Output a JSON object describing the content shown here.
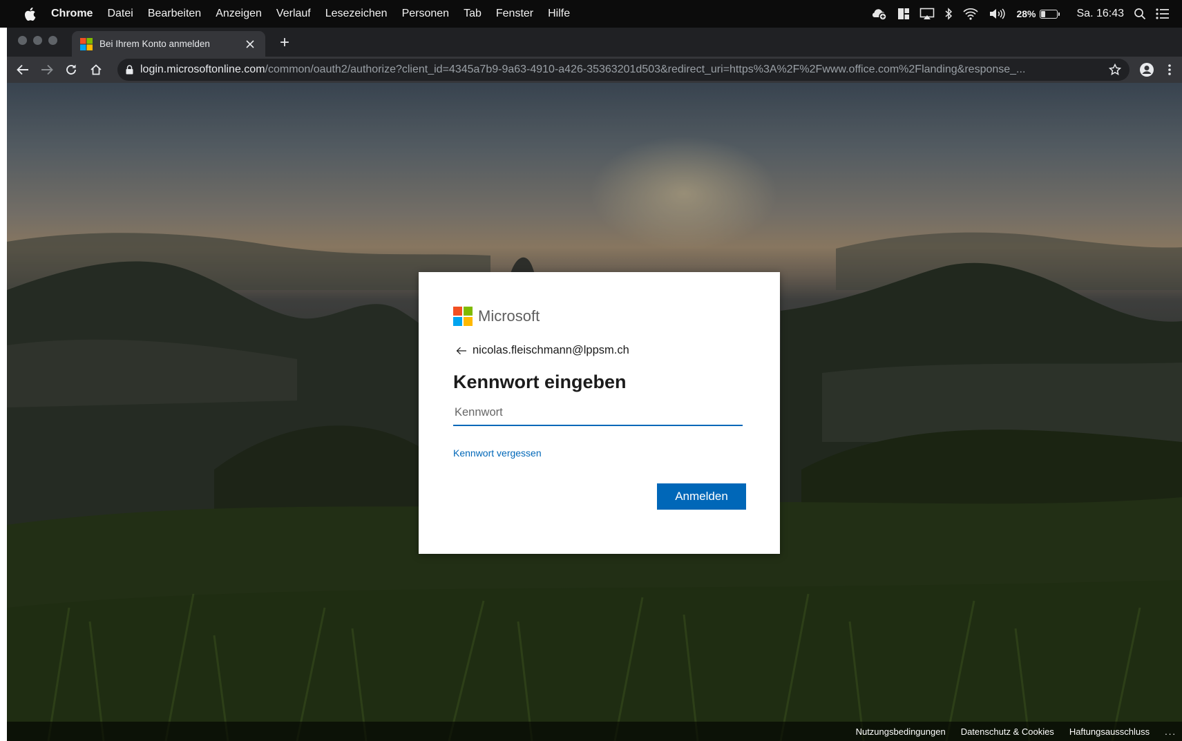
{
  "menubar": {
    "app_name": "Chrome",
    "items": [
      "Datei",
      "Bearbeiten",
      "Anzeigen",
      "Verlauf",
      "Lesezeichen",
      "Personen",
      "Tab",
      "Fenster",
      "Hilfe"
    ],
    "battery_percent": "28%",
    "battery_level": 0.28,
    "clock": "Sa. 16:43"
  },
  "browser": {
    "tab_title": "Bei Ihrem Konto anmelden",
    "new_tab_label": "+",
    "url_host": "login.microsoftonline.com",
    "url_path": "/common/oauth2/authorize?client_id=4345a7b9-9a63-4910-a426-35363201d503&redirect_uri=https%3A%2F%2Fwww.office.com%2Flanding&response_..."
  },
  "signin": {
    "brand": "Microsoft",
    "account_email": "nicolas.fleischmann@lppsm.ch",
    "heading": "Kennwort eingeben",
    "password_placeholder": "Kennwort",
    "password_value": "",
    "forgot_link": "Kennwort vergessen",
    "submit_label": "Anmelden"
  },
  "footer": {
    "links": [
      "Nutzungsbedingungen",
      "Datenschutz & Cookies",
      "Haftungsausschluss"
    ],
    "more": "..."
  },
  "colors": {
    "ms_red": "#f25022",
    "ms_green": "#7fba00",
    "ms_blue": "#00a4ef",
    "ms_yellow": "#ffb900",
    "accent_blue": "#0067b8"
  }
}
